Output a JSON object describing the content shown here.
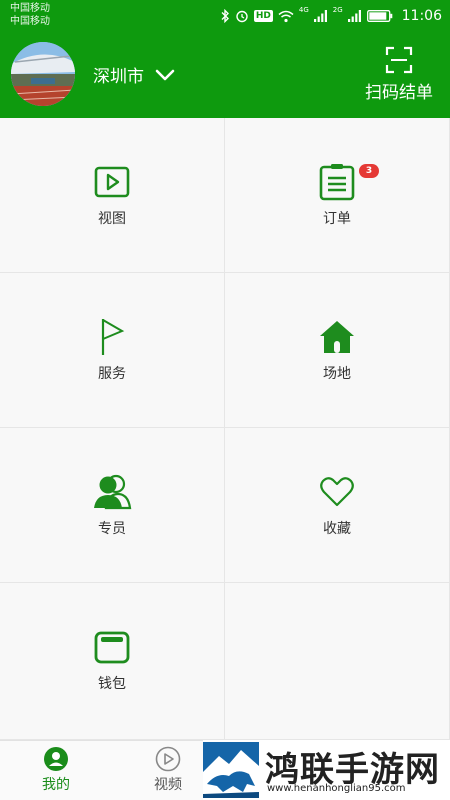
{
  "status_bar": {
    "carrier1": "中国移动",
    "carrier2": "中国移动",
    "network1": "4G",
    "network2": "2G",
    "hd": "HD",
    "time": "11:06"
  },
  "header": {
    "city": "深圳市",
    "scan_label": "扫码结单",
    "accent_color": "#0e9a0e"
  },
  "grid": {
    "items": [
      {
        "label": "视图",
        "icon": "video-play-icon"
      },
      {
        "label": "订单",
        "icon": "clipboard-list-icon",
        "badge": "3"
      },
      {
        "label": "服务",
        "icon": "flag-icon"
      },
      {
        "label": "场地",
        "icon": "home-icon"
      },
      {
        "label": "专员",
        "icon": "users-icon"
      },
      {
        "label": "收藏",
        "icon": "heart-icon"
      },
      {
        "label": "钱包",
        "icon": "wallet-icon"
      }
    ]
  },
  "tabbar": {
    "tabs": [
      {
        "label": "我的",
        "icon": "user-icon",
        "active": true
      },
      {
        "label": "视频",
        "icon": "play-circle-icon",
        "active": false
      }
    ]
  },
  "watermark": {
    "title": "鸿联手游网",
    "url": "www.henanhonglian95.com"
  }
}
